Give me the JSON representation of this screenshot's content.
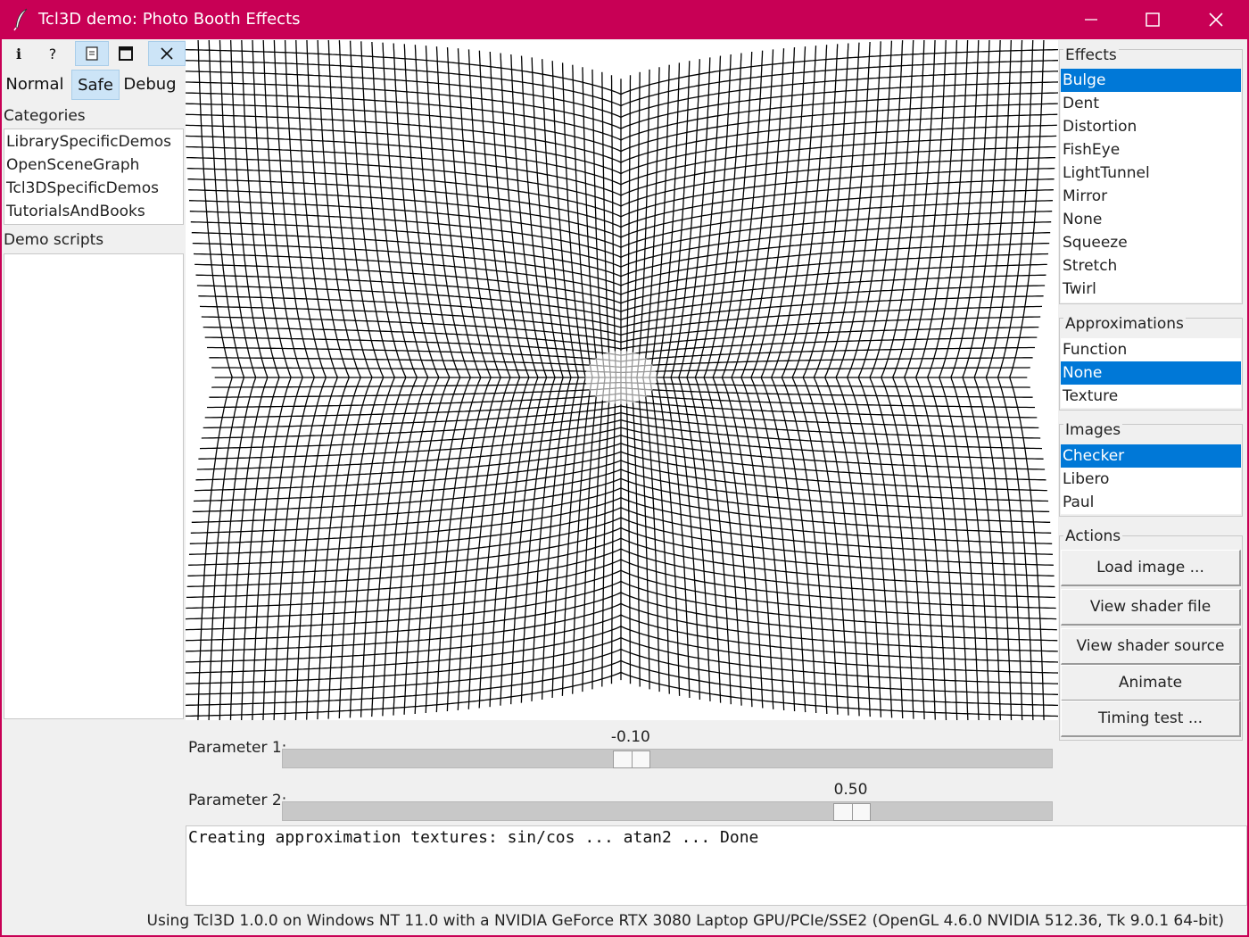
{
  "window": {
    "title": "Tcl3D demo: Photo Booth Effects",
    "accent_color": "#c80055",
    "controls": [
      "minimize-icon",
      "maximize-icon",
      "close-icon"
    ]
  },
  "toolbar": {
    "icons": [
      "info-icon",
      "help-icon",
      "document-icon",
      "window-icon",
      "close-icon"
    ],
    "info_glyph": "i",
    "help_glyph": "?"
  },
  "modes": {
    "items": [
      "Normal",
      "Safe",
      "Debug"
    ],
    "selected": "Safe"
  },
  "categories": {
    "label": "Categories",
    "items": [
      "LibrarySpecificDemos",
      "OpenSceneGraph",
      "Tcl3DSpecificDemos",
      "TutorialsAndBooks"
    ]
  },
  "demo_scripts": {
    "label": "Demo scripts",
    "items": []
  },
  "canvas": {
    "image": "Checker",
    "effect": "Bulge"
  },
  "parameters": [
    {
      "label": "Parameter 1:",
      "value": "-0.10",
      "min": -1.0,
      "max": 1.0,
      "numeric": -0.1
    },
    {
      "label": "Parameter 2:",
      "value": "0.50",
      "min": -1.0,
      "max": 1.0,
      "numeric": 0.5
    }
  ],
  "log": {
    "text": "Creating approximation textures: sin/cos ... atan2 ... Done"
  },
  "statusbar": {
    "text": "Using Tcl3D 1.0.0 on Windows NT 11.0 with a NVIDIA GeForce RTX 3080 Laptop GPU/PCIe/SSE2 (OpenGL 4.6.0 NVIDIA 512.36, Tk 9.0.1 64-bit)"
  },
  "effects": {
    "label": "Effects",
    "items": [
      "Bulge",
      "Dent",
      "Distortion",
      "FishEye",
      "LightTunnel",
      "Mirror",
      "None",
      "Squeeze",
      "Stretch",
      "Twirl"
    ],
    "selected": "Bulge"
  },
  "approximations": {
    "label": "Approximations",
    "items": [
      "Function",
      "None",
      "Texture"
    ],
    "selected": "None"
  },
  "images": {
    "label": "Images",
    "items": [
      "Checker",
      "Libero",
      "Paul"
    ],
    "selected": "Checker"
  },
  "actions": {
    "label": "Actions",
    "items": [
      "Load image ...",
      "View shader file",
      "View shader source",
      "Animate",
      "Timing test ..."
    ]
  },
  "colors": {
    "selection": "#0078d7",
    "window_bg": "#f0f0f0"
  }
}
